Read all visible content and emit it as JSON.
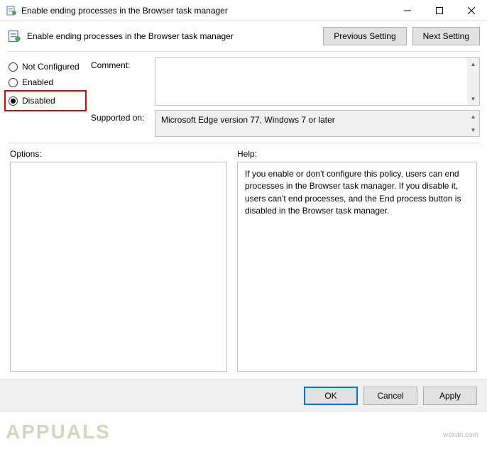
{
  "window": {
    "title": "Enable ending processes in the Browser task manager"
  },
  "header": {
    "title": "Enable ending processes in the Browser task manager",
    "previous_setting": "Previous Setting",
    "next_setting": "Next Setting"
  },
  "radios": {
    "not_configured": "Not Configured",
    "enabled": "Enabled",
    "disabled": "Disabled",
    "selected": "disabled"
  },
  "fields": {
    "comment_label": "Comment:",
    "comment_value": "",
    "supported_label": "Supported on:",
    "supported_value": "Microsoft Edge version 77, Windows 7 or later"
  },
  "panels": {
    "options_label": "Options:",
    "options_value": "",
    "help_label": "Help:",
    "help_value": "If you enable or don't configure this policy, users can end processes in the Browser task manager. If you disable it, users can't end processes, and the End process button is disabled in the Browser task manager."
  },
  "footer": {
    "ok": "OK",
    "cancel": "Cancel",
    "apply": "Apply"
  },
  "watermark": {
    "brand": "APPUALS",
    "site": "wsxdn.com"
  }
}
